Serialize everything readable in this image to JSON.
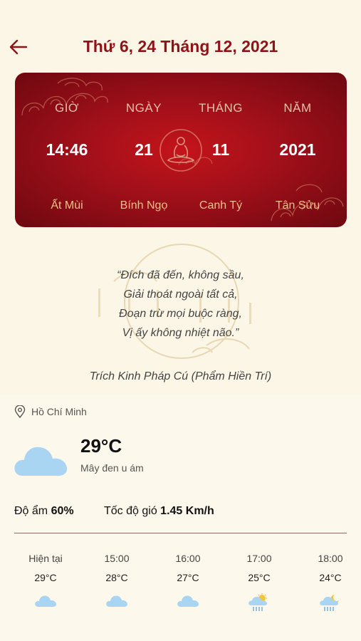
{
  "header": {
    "title": "Thứ 6, 24 Tháng 12, 2021"
  },
  "lunar": {
    "columns": [
      {
        "label": "GIỜ",
        "value": "14:46",
        "canchi": "Ất Mùi"
      },
      {
        "label": "NGÀY",
        "value": "21",
        "canchi": "Bính Ngọ"
      },
      {
        "label": "THÁNG",
        "value": "11",
        "canchi": "Canh Tý"
      },
      {
        "label": "NĂM",
        "value": "2021",
        "canchi": "Tân Sửu"
      }
    ]
  },
  "quote": {
    "lines": [
      "“Đích đã đến, không sầu,",
      "Giải thoát ngoài tất cả,",
      "Đoạn trừ mọi buộc ràng,",
      "Vị ấy không nhiệt não.”"
    ],
    "source": "Trích Kinh Pháp Cú (Phẩm Hiền Trí)"
  },
  "weather": {
    "location": "Hồ Chí Minh",
    "temp": "29°C",
    "description": "Mây đen u ám",
    "humidity_label": "Độ ẩm",
    "humidity_value": "60%",
    "wind_label": "Tốc độ gió",
    "wind_value": "1.45 Km/h",
    "hourly": [
      {
        "time": "Hiện tại",
        "temp": "29°C",
        "icon": "cloud-icon"
      },
      {
        "time": "15:00",
        "temp": "28°C",
        "icon": "cloud-icon"
      },
      {
        "time": "16:00",
        "temp": "27°C",
        "icon": "cloud-icon"
      },
      {
        "time": "17:00",
        "temp": "25°C",
        "icon": "sun-rain-icon"
      },
      {
        "time": "18:00",
        "temp": "24°C",
        "icon": "moon-rain-icon"
      }
    ]
  },
  "colors": {
    "brand_red": "#8f1418",
    "card_red": "#b3121a",
    "background": "#fcf6e6",
    "cloud_blue": "#a9d4f2"
  }
}
